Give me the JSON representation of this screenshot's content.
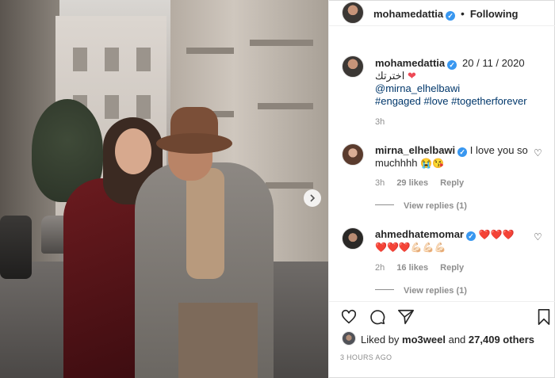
{
  "post": {
    "author": "mohamedattia",
    "follow_separator": "•",
    "follow_state": "Following"
  },
  "caption": {
    "username": "mohamedattia",
    "date": "20 / 11 / 2020",
    "text": "اخترتك",
    "mention": "@mirna_elhelbawi",
    "hashtags": "#engaged #love #togetherforever",
    "time": "3h"
  },
  "comments": [
    {
      "username": "mirna_elhelbawi",
      "text_line1": "I love you so",
      "text_line2": "muchhhh",
      "emoji": "😭😘",
      "time": "3h",
      "likes": "29 likes",
      "reply_label": "Reply",
      "view_replies": "View replies (1)"
    },
    {
      "username": "ahmedhatemomar",
      "line1_emoji": "❤️❤️❤️",
      "line2_emoji": "❤️❤️❤️💪🏻💪🏻💪🏻",
      "time": "2h",
      "likes": "16 likes",
      "reply_label": "Reply",
      "view_replies": "View replies (1)"
    }
  ],
  "liked_by": {
    "prefix": "Liked by",
    "user": "mo3weel",
    "connector": "and",
    "others": "27,409 others"
  },
  "timestamp": "3 HOURS AGO",
  "icons": {
    "next": "chevron-right-icon",
    "like": "heart-icon",
    "comment": "comment-icon",
    "share": "share-icon",
    "save": "bookmark-icon"
  },
  "colors": {
    "verified": "#3897f0",
    "link": "#00376b",
    "heart": "#ed4956",
    "muted": "#8e8e8e"
  }
}
